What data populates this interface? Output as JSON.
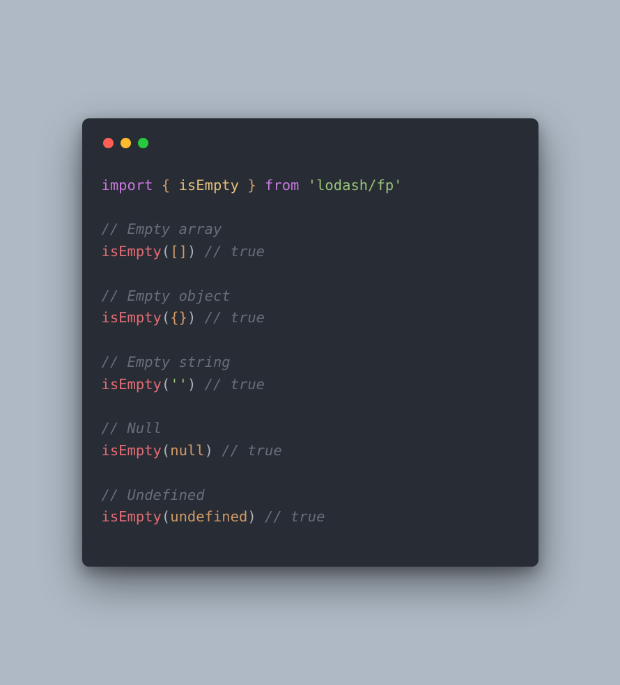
{
  "colors": {
    "bg": "#aeb9c5",
    "editor": "#282c34",
    "red": "#ff5f56",
    "yellow": "#ffbd2e",
    "green": "#27c93f",
    "keyword": "#c678dd",
    "brace": "#d19a66",
    "function": "#e5c07b",
    "call": "#e06c75",
    "string": "#98c379",
    "literal": "#d19a66",
    "comment": "#676e7b",
    "plain": "#abb2bf"
  },
  "code": {
    "import_kw": "import",
    "lbrace": " { ",
    "import_name": "isEmpty",
    "rbrace": " } ",
    "from_kw": "from",
    "space": " ",
    "module": "'lodash/fp'",
    "c1": "// Empty array",
    "call1_fn": "isEmpty",
    "call1_args_open": "(",
    "call1_args_inner": "[]",
    "call1_args_close": ") ",
    "call1_comment": "// true",
    "c2": "// Empty object",
    "call2_fn": "isEmpty",
    "call2_args_open": "(",
    "call2_args_inner": "{}",
    "call2_args_close": ") ",
    "call2_comment": "// true",
    "c3": "// Empty string",
    "call3_fn": "isEmpty",
    "call3_args_open": "(",
    "call3_args_inner": "''",
    "call3_args_close": ") ",
    "call3_comment": "// true",
    "c4": "// Null",
    "call4_fn": "isEmpty",
    "call4_args_open": "(",
    "call4_args_inner": "null",
    "call4_args_close": ") ",
    "call4_comment": "// true",
    "c5": "// Undefined",
    "call5_fn": "isEmpty",
    "call5_args_open": "(",
    "call5_args_inner": "undefined",
    "call5_args_close": ") ",
    "call5_comment": "// true"
  }
}
